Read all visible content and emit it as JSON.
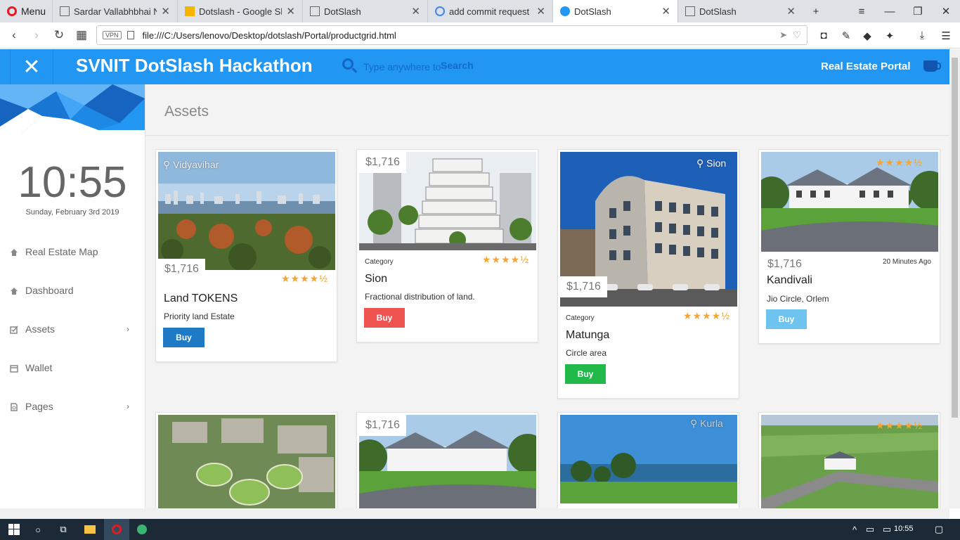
{
  "browser": {
    "menu_label": "Menu",
    "tabs": [
      {
        "title": "Sardar Vallabhbhai Nati",
        "icon": "document-icon"
      },
      {
        "title": "Dotslash - Google Slide",
        "icon": "slides-icon"
      },
      {
        "title": "DotSlash",
        "icon": "document-icon"
      },
      {
        "title": "add commit request to",
        "icon": "google-icon"
      },
      {
        "title": "DotSlash",
        "icon": "app-icon"
      },
      {
        "title": "DotSlash",
        "icon": "document-icon"
      }
    ],
    "url": "file:///C:/Users/lenovo/Desktop/dotslash/Portal/productgrid.html",
    "vpn_label": "VPN"
  },
  "header": {
    "brand": "SVNIT DotSlash Hackathon",
    "search_placeholder": "Type anywhere to",
    "search_bold": "Search",
    "portal_label": "Real Estate Portal",
    "accent_color": "#2196f3"
  },
  "sidebar": {
    "clock": "10:55",
    "date": "Sunday, February 3rd 2019",
    "items": [
      {
        "label": "Real Estate Map",
        "icon": "home-icon",
        "has_arrow": false
      },
      {
        "label": "Dashboard",
        "icon": "home-icon",
        "has_arrow": false
      },
      {
        "label": "Assets",
        "icon": "checkbox-icon",
        "has_arrow": true
      },
      {
        "label": "Wallet",
        "icon": "calendar-icon",
        "has_arrow": false
      },
      {
        "label": "Pages",
        "icon": "file-icon",
        "has_arrow": true
      }
    ],
    "arrow_glyph": "›"
  },
  "main": {
    "title": "Assets",
    "cards": [
      {
        "location": "Vidyavihar",
        "price": "$1,716",
        "name": "Land TOKENS",
        "description": "Priority land Estate",
        "button": "Buy",
        "rating": 4.5
      },
      {
        "price": "$1,716",
        "category": "Category",
        "name": "Sion",
        "description": "Fractional distribution of land.",
        "button": "Buy",
        "rating": 4.5
      },
      {
        "location": "Sion",
        "price": "$1,716",
        "category": "Category",
        "name": "Matunga",
        "description": "Circle area",
        "button": "Buy",
        "rating": 4.5
      },
      {
        "price": "$1,716",
        "time": "20 Minutes Ago",
        "name": "Kandivali",
        "description": "Jio Circle, Orlem",
        "button": "Buy",
        "rating": 4.5
      },
      {
        "price": "$1,716"
      },
      {
        "location": "Kurla"
      },
      {
        "rating": 4.5
      }
    ],
    "star_glyphs": "★★★★½",
    "button_colors": {
      "blue": "#1e7ac4",
      "red": "#ef5350",
      "green": "#21b94a",
      "light_blue": "#6fc3ef"
    }
  },
  "taskbar": {
    "clock": "10:55"
  }
}
